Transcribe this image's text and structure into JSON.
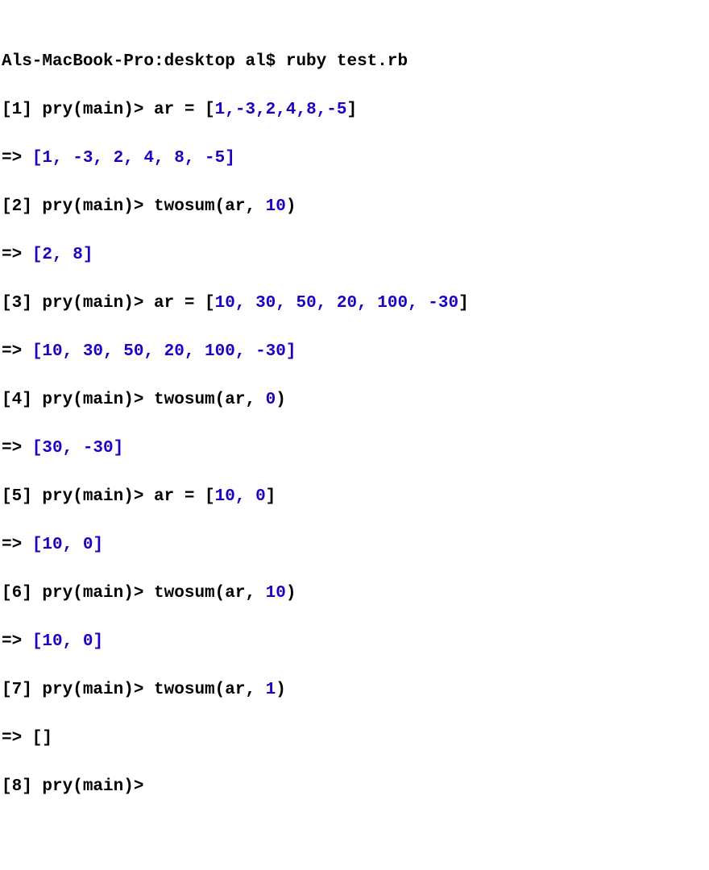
{
  "lines": {
    "shell_prompt": "Als-MacBook-Pro:desktop al$ ruby test.rb",
    "l1": {
      "prompt": "[1] pry(main)> ",
      "code": "ar = [",
      "vals": "1,-3,2,4,8,-5",
      "close": "]"
    },
    "r1": {
      "arrow": "=> ",
      "open": "[",
      "vals": "1, -3, 2, 4, 8, -5",
      "close": "]"
    },
    "l2": {
      "prompt": "[2] pry(main)> ",
      "code": "twosum(ar, ",
      "val": "10",
      "close": ")"
    },
    "r2": {
      "arrow": "=> ",
      "open": "[",
      "vals": "2, 8",
      "close": "]"
    },
    "l3": {
      "prompt": "[3] pry(main)> ",
      "code": "ar = [",
      "vals": "10, 30, 50, 20, 100, -30",
      "close": "]"
    },
    "r3": {
      "arrow": "=> ",
      "open": "[",
      "vals": "10, 30, 50, 20, 100, -30",
      "close": "]"
    },
    "l4": {
      "prompt": "[4] pry(main)> ",
      "code": "twosum(ar, ",
      "val": "0",
      "close": ")"
    },
    "r4": {
      "arrow": "=> ",
      "open": "[",
      "vals": "30, -30",
      "close": "]"
    },
    "l5": {
      "prompt": "[5] pry(main)> ",
      "code": "ar = [",
      "vals": "10, 0",
      "close": "]"
    },
    "r5": {
      "arrow": "=> ",
      "open": "[",
      "vals": "10, 0",
      "close": "]"
    },
    "l6": {
      "prompt": "[6] pry(main)> ",
      "code": "twosum(ar, ",
      "val": "10",
      "close": ")"
    },
    "r6": {
      "arrow": "=> ",
      "open": "[",
      "vals": "10, 0",
      "close": "]"
    },
    "l7": {
      "prompt": "[7] pry(main)> ",
      "code": "twosum(ar, ",
      "val": "1",
      "close": ")"
    },
    "r7": {
      "arrow": "=> []"
    },
    "l8": {
      "prompt": "[8] pry(main)> "
    }
  }
}
